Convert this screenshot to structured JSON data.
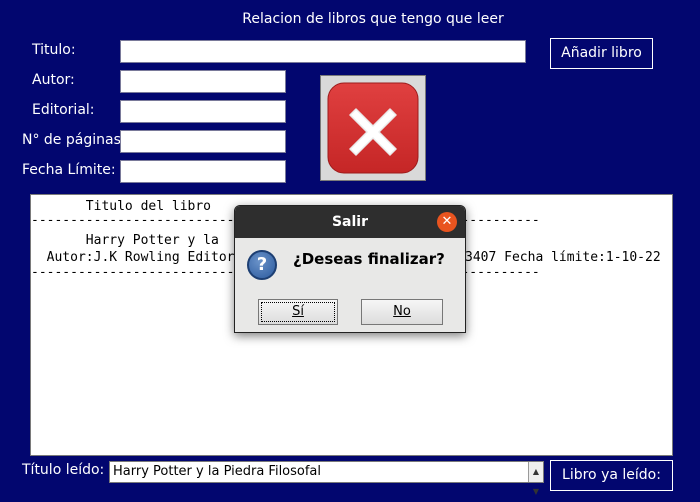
{
  "colors": {
    "background": "#02066f",
    "close_button": "#e9541f",
    "image_red": "#d32f2f"
  },
  "window": {
    "heading": "Relacion de libros que tengo que leer"
  },
  "form": {
    "titulo_label": "Titulo:",
    "autor_label": "Autor:",
    "editorial_label": "Editorial:",
    "paginas_label": "N° de páginas:",
    "fecha_label": "Fecha Límite:",
    "titulo_value": "",
    "autor_value": "",
    "editorial_value": "",
    "paginas_value": "",
    "fecha_value": ""
  },
  "buttons": {
    "add_book": "Añadir libro",
    "book_read": "Libro ya leído:",
    "image_button_icon": "x-mark-icon"
  },
  "list": {
    "lines": [
      "       Titulo del libro",
      "-----------------------------------------------------------------",
      "       Harry Potter y la",
      "  Autor:J.K Rowling Editor",
      "-----------------------------------------------------------------"
    ],
    "line2_tail": "3407 Fecha límite:1-10-22"
  },
  "bottom": {
    "read_label": "Título leído:",
    "read_selected": "Harry Potter y la Piedra Filosofal"
  },
  "dialog": {
    "title": "Salir",
    "message": "¿Deseas finalizar?",
    "yes_label": "Sí",
    "no_label": "No",
    "icon": "question-icon"
  }
}
